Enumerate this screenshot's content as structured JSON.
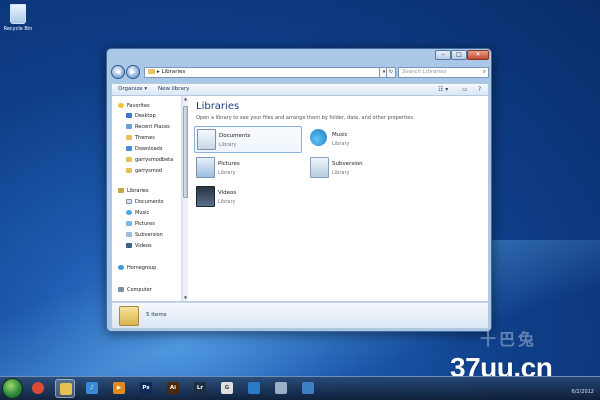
{
  "desktop": {
    "recycle_bin_label": "Recycle Bin"
  },
  "window": {
    "title_buttons": {
      "minimize": "–",
      "maximize": "□",
      "close": "✕"
    },
    "address": {
      "separator": "▸",
      "path": "Libraries",
      "dropdown": "▾",
      "refresh": "↻"
    },
    "search_placeholder": "Search Libraries",
    "search_icon": "⌕",
    "back_arrow": "◀",
    "forward_arrow": "▶",
    "commands": {
      "organize": "Organize ▾",
      "new_library": "New library"
    },
    "view_controls": {
      "views": "☷ ▾",
      "preview": "▭",
      "help": "?"
    }
  },
  "nav_pane": {
    "scroll_up": "▲",
    "scroll_down": "▼",
    "favorites": {
      "label": "Favorites",
      "items": [
        "Desktop",
        "Recent Places",
        "Themes",
        "Downloads",
        "garrysmodbeta",
        "garrysmod"
      ]
    },
    "libraries": {
      "label": "Libraries",
      "items": [
        "Documents",
        "Music",
        "Pictures",
        "Subversion",
        "Videos"
      ]
    },
    "homegroup": "Homegroup",
    "computer": "Computer"
  },
  "main": {
    "title": "Libraries",
    "description": "Open a library to see your files and arrange them by folder, date, and other properties.",
    "libraries": [
      {
        "name": "Documents",
        "type": "Library",
        "icon": "documents-icon",
        "selected": true
      },
      {
        "name": "Music",
        "type": "Library",
        "icon": "music-icon",
        "selected": false
      },
      {
        "name": "Pictures",
        "type": "Library",
        "icon": "pictures-icon",
        "selected": false
      },
      {
        "name": "Subversion",
        "type": "Library",
        "icon": "subversion-icon",
        "selected": false
      },
      {
        "name": "Videos",
        "type": "Library",
        "icon": "videos-icon",
        "selected": false
      }
    ]
  },
  "details_pane": {
    "item_count": "5 items"
  },
  "taskbar": {
    "apps": [
      {
        "icon": "chrome-icon",
        "glyph": "",
        "color": "#d94a38",
        "active": false
      },
      {
        "icon": "explorer-icon",
        "glyph": "",
        "color": "#e6c055",
        "active": true
      },
      {
        "icon": "itunes-icon",
        "glyph": "♪",
        "color": "#3a8ad8",
        "active": false
      },
      {
        "icon": "media-player-icon",
        "glyph": "▶",
        "color": "#e08a1e",
        "active": false
      },
      {
        "icon": "photoshop-icon",
        "glyph": "Ps",
        "color": "#0c2a5a",
        "active": false
      },
      {
        "icon": "illustrator-icon",
        "glyph": "Ai",
        "color": "#4a2a08",
        "active": false
      },
      {
        "icon": "lightroom-icon",
        "glyph": "Lr",
        "color": "#1e2e40",
        "active": false
      },
      {
        "icon": "garrysmod-icon",
        "glyph": "G",
        "color": "#e0e0e0",
        "active": false
      },
      {
        "icon": "steam-icon",
        "glyph": "",
        "color": "#2a7ac8",
        "active": false
      },
      {
        "icon": "notes-icon",
        "glyph": "",
        "color": "#9ab0c8",
        "active": false
      },
      {
        "icon": "remote-desktop-icon",
        "glyph": "",
        "color": "#3d7ec4",
        "active": false
      }
    ],
    "clock": "6/2/2012"
  },
  "watermark": {
    "chinese": "十巴兔",
    "url": "37uu.cn"
  }
}
